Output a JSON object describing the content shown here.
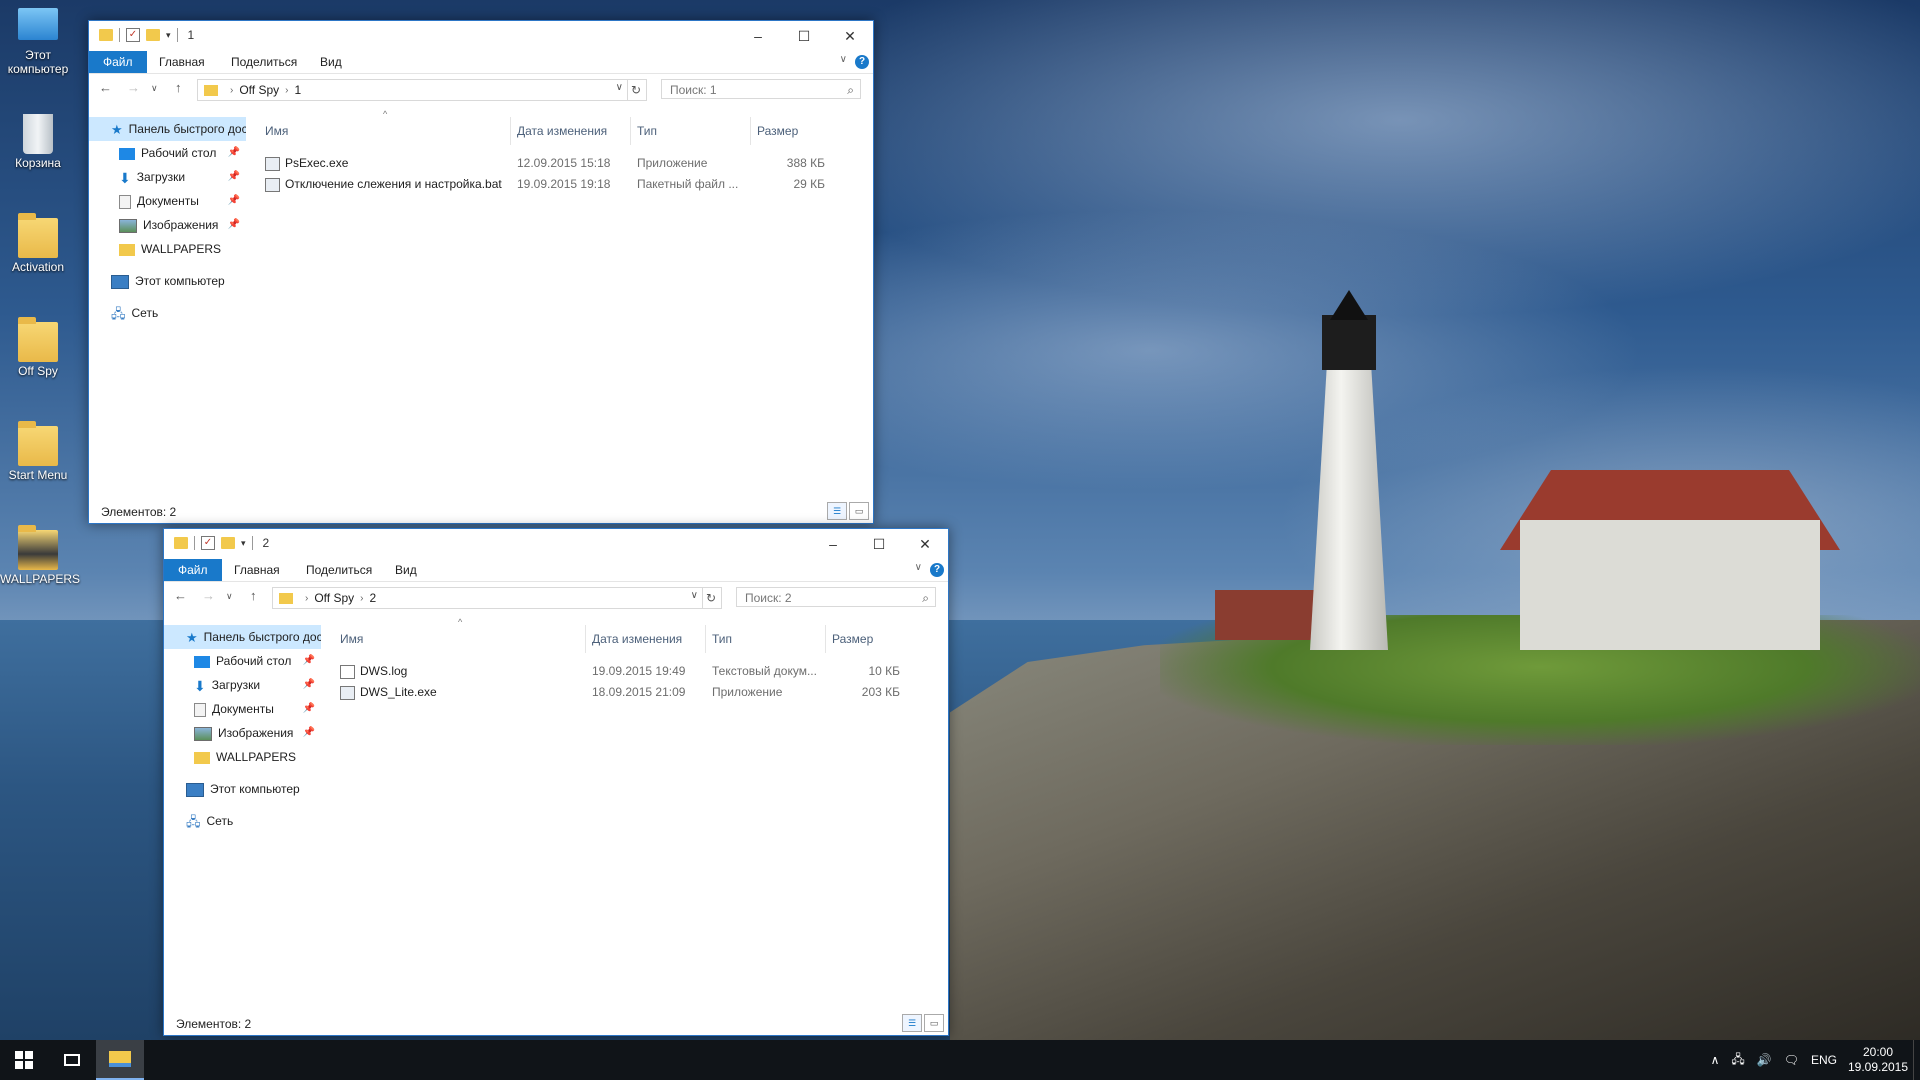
{
  "desktop": {
    "icons": [
      {
        "label": "Этот компьютер",
        "icon": "computer-icon"
      },
      {
        "label": "Корзина",
        "icon": "recycle-bin-icon"
      },
      {
        "label": "Activation",
        "icon": "folder-icon"
      },
      {
        "label": "Off Spy",
        "icon": "folder-icon"
      },
      {
        "label": "Start Menu",
        "icon": "folder-icon"
      },
      {
        "label": "WALLPAPERS",
        "icon": "folder-icon"
      }
    ]
  },
  "windows": [
    {
      "title": "1",
      "ribbon": {
        "file": "Файл",
        "home": "Главная",
        "share": "Поделиться",
        "view": "Вид"
      },
      "path": [
        "Off Spy",
        "1"
      ],
      "search_placeholder": "Поиск: 1",
      "nav": {
        "quick_access": "Панель быстрого доступа",
        "desktop": "Рабочий стол",
        "downloads": "Загрузки",
        "documents": "Документы",
        "images": "Изображения",
        "wallpapers": "WALLPAPERS",
        "this_pc": "Этот компьютер",
        "network": "Сеть"
      },
      "columns": {
        "name": "Имя",
        "date": "Дата изменения",
        "type": "Тип",
        "size": "Размер"
      },
      "files": [
        {
          "name": "PsExec.exe",
          "date": "12.09.2015 15:18",
          "type": "Приложение",
          "size": "388 КБ"
        },
        {
          "name": "Отключение слежения и настройка.bat",
          "date": "19.09.2015 19:18",
          "type": "Пакетный файл ...",
          "size": "29 КБ"
        }
      ],
      "status": "Элементов: 2"
    },
    {
      "title": "2",
      "ribbon": {
        "file": "Файл",
        "home": "Главная",
        "share": "Поделиться",
        "view": "Вид"
      },
      "path": [
        "Off Spy",
        "2"
      ],
      "search_placeholder": "Поиск: 2",
      "nav": {
        "quick_access": "Панель быстрого доступа",
        "desktop": "Рабочий стол",
        "downloads": "Загрузки",
        "documents": "Документы",
        "images": "Изображения",
        "wallpapers": "WALLPAPERS",
        "this_pc": "Этот компьютер",
        "network": "Сеть"
      },
      "columns": {
        "name": "Имя",
        "date": "Дата изменения",
        "type": "Тип",
        "size": "Размер"
      },
      "files": [
        {
          "name": "DWS.log",
          "date": "19.09.2015 19:49",
          "type": "Текстовый докум...",
          "size": "10 КБ"
        },
        {
          "name": "DWS_Lite.exe",
          "date": "18.09.2015 21:09",
          "type": "Приложение",
          "size": "203 КБ"
        }
      ],
      "status": "Элементов: 2"
    }
  ],
  "taskbar": {
    "language": "ENG",
    "time": "20:00",
    "date": "19.09.2015"
  },
  "colors": {
    "accent": "#1979ca",
    "taskbar": "#101418"
  }
}
